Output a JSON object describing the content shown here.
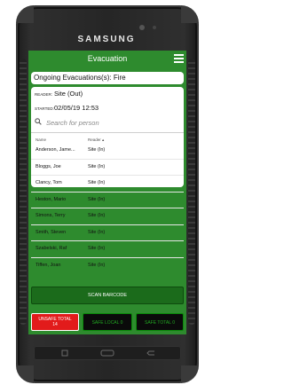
{
  "device": {
    "brand": "SAMSUNG"
  },
  "app": {
    "title": "Evacuation",
    "banner": "Ongoing Evacuations(s): Fire",
    "reader_label": "READER:",
    "reader_value": "Site (Out)",
    "started_label": "STARTED:",
    "started_value": "02/05/19 12:53",
    "search": {
      "placeholder": "Search for person"
    },
    "columns": {
      "name": "Name",
      "reader": "Reader ▴"
    },
    "people": [
      {
        "name": "Anderson, Jame...",
        "reader": "Site (In)"
      },
      {
        "name": "Bloggs, Joe",
        "reader": "Site (In)"
      },
      {
        "name": "Clancy, Tom",
        "reader": "Site (In)"
      },
      {
        "name": "Heston, Mario",
        "reader": "Site (In)"
      },
      {
        "name": "Simons, Terry",
        "reader": "Site (In)"
      },
      {
        "name": "Smith, Steven",
        "reader": "Site (In)"
      },
      {
        "name": "Szabelski, Raf",
        "reader": "Site (In)"
      },
      {
        "name": "Tiffen, Joan",
        "reader": "Site (In)"
      }
    ],
    "scan_button": "SCAN BARCODE",
    "totals": {
      "unsafe_label": "UNSAFE TOTAL",
      "unsafe_value": "14",
      "safe_local": "SAFE LOCAL 0",
      "safe_total": "SAFE TOTAL 0"
    }
  },
  "colors": {
    "app_green": "#2e8b2e",
    "button_green": "#1b6b1b",
    "unsafe_red": "#e21b1b",
    "safe_green_text": "#21a821"
  },
  "icons": [
    "menu-icon",
    "search-icon",
    "recent-apps-icon",
    "home-icon",
    "back-icon"
  ]
}
